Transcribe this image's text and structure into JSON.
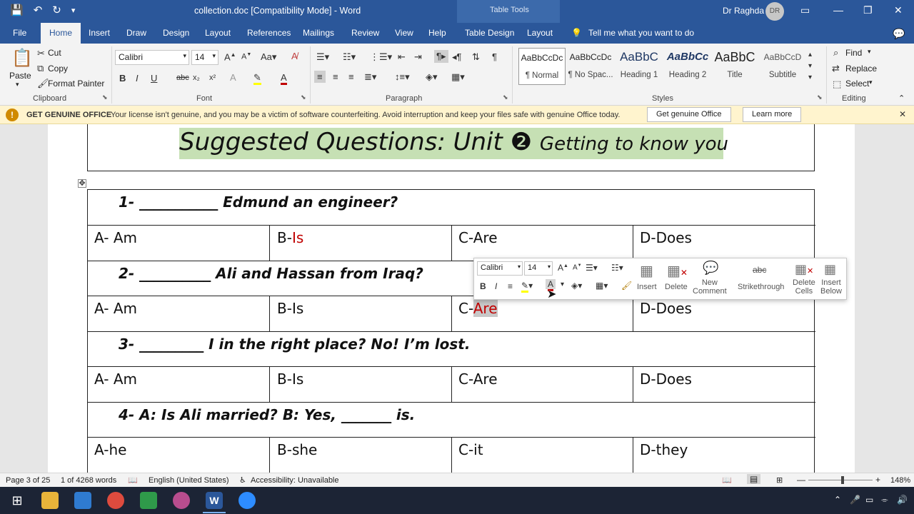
{
  "titlebar": {
    "doc_title": "collection.doc [Compatibility Mode]  -  Word",
    "contextual_group": "Table Tools",
    "user_name": "Dr Raghda",
    "avatar_initials": "DR"
  },
  "tabs": [
    "File",
    "Home",
    "Insert",
    "Draw",
    "Design",
    "Layout",
    "References",
    "Mailings",
    "Review",
    "View",
    "Help",
    "Table Design",
    "Layout"
  ],
  "tell_me": "Tell me what you want to do",
  "clipboard": {
    "paste": "Paste",
    "cut": "Cut",
    "copy": "Copy",
    "format_painter": "Format Painter",
    "label": "Clipboard"
  },
  "font": {
    "name": "Calibri",
    "size": "14",
    "label": "Font"
  },
  "paragraph": {
    "label": "Paragraph"
  },
  "styles": {
    "label": "Styles",
    "items": [
      {
        "preview": "AaBbCcDc",
        "name": "¶ Normal"
      },
      {
        "preview": "AaBbCcDc",
        "name": "¶ No Spac..."
      },
      {
        "preview": "AaBbC",
        "name": "Heading 1"
      },
      {
        "preview": "AaBbCc",
        "name": "Heading 2"
      },
      {
        "preview": "AaBbC",
        "name": "Title"
      },
      {
        "preview": "AaBbCcD",
        "name": "Subtitle"
      }
    ]
  },
  "editing": {
    "find": "Find",
    "replace": "Replace",
    "select": "Select",
    "label": "Editing"
  },
  "message_bar": {
    "heading": "GET GENUINE OFFICE",
    "text": "Your license isn't genuine, and you may be a victim of software counterfeiting. Avoid interruption and keep your files safe with genuine Office today.",
    "btn_genuine": "Get genuine Office",
    "btn_learn": "Learn more"
  },
  "document": {
    "heading_main": "Suggested Questions: Unit ❷ ",
    "heading_sub": "Getting to know you",
    "q1": "1-  ___________  Edmund an engineer?",
    "r1": {
      "a": "A- Am",
      "b_prefix": "B-",
      "b_red": "Is",
      "c": "C-Are",
      "d": "D-Does"
    },
    "q2": "2-  __________  Ali and Hassan from Iraq?",
    "r2": {
      "a": "A- Am",
      "b": "B-Is",
      "c_prefix": "C-",
      "c_red": "Are",
      "d": "D-Does"
    },
    "q3": "3-  _________  I in the right place? No! I’m lost.",
    "r3": {
      "a": "A- Am",
      "b": "B-Is",
      "c": "C-Are",
      "d": "D-Does"
    },
    "q4": "4-  A: Is Ali married? B: Yes, _______  is.",
    "r4": {
      "a": "A-he",
      "b": "B-she",
      "c": "C-it",
      "d": "D-they"
    }
  },
  "mini_toolbar": {
    "font": "Calibri",
    "size": "14",
    "insert": "Insert",
    "delete": "Delete",
    "new_comment_1": "New",
    "new_comment_2": "Comment",
    "strikethrough": "Strikethrough",
    "delete_cells_1": "Delete",
    "delete_cells_2": "Cells",
    "insert_below_1": "Insert",
    "insert_below_2": "Below"
  },
  "statusbar": {
    "page": "Page 3 of 25",
    "words": "1 of 4268 words",
    "language": "English (United States)",
    "accessibility": "Accessibility: Unavailable",
    "zoom": "148%"
  },
  "colors": {
    "accent": "#2b579a",
    "font_red": "#c00000",
    "highlight": "#c6e0b4"
  }
}
